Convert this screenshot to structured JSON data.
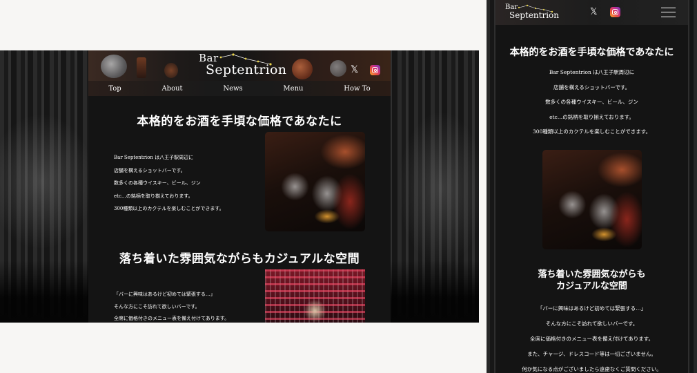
{
  "brand": {
    "line1": "Bar",
    "line2": "Septentrion"
  },
  "social": {
    "x_glyph": "𝕏"
  },
  "nav": [
    "Top",
    "About",
    "News",
    "Menu",
    "How To"
  ],
  "section1": {
    "heading": "本格的をお酒を手頃な価格であなたに",
    "lines": [
      "Bar Septentrion は八王子駅周辺に",
      "店舗を構えるショットバーです。",
      "数多くの各種ウイスキー、ビール、ジン",
      "etc…の銘柄を取り揃えております。",
      "300種類以上のカクテルを楽しむことができます。"
    ]
  },
  "section2": {
    "heading": "落ち着いた雰囲気ながらもカジュアルな空間",
    "heading_mobile": [
      "落ち着いた雰囲気ながらも",
      "カジュアルな空間"
    ],
    "lines": [
      "「バーに興味はあるけど初めては緊張する…」",
      "そんな方にこそ訪れて欲しいバーです。",
      "全席に価格付きのメニュー表を備え付けてあります。",
      "また、チャージ、ドレスコード等は一切ございません。",
      "何か気になる点がございましたら遠慮なくご質問ください。"
    ]
  },
  "colors": {
    "page_bg": "#141414",
    "text": "#ffffff",
    "accent_gold": "#e8d34a"
  },
  "icons": [
    "x-logo-icon",
    "instagram-icon",
    "hamburger-menu-icon",
    "constellation-icon"
  ]
}
